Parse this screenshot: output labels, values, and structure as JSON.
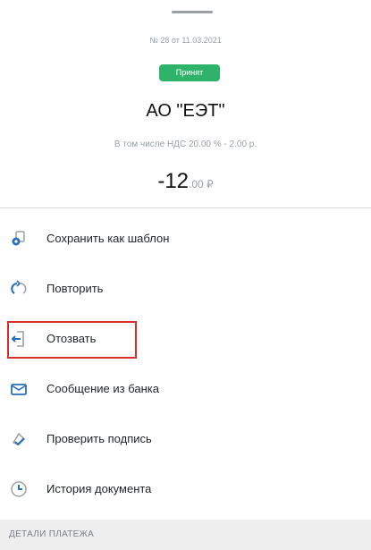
{
  "header": {
    "doc_number": "№ 28   от 11.03.2021",
    "status_badge": "Принят",
    "company": "АО \"ЕЭТ\"",
    "vat_text": "В том числе НДС 20.00 % - 2.00 р.",
    "amount_main": "-12",
    "amount_cents": ".00 ₽"
  },
  "menu": {
    "save_template": "Сохранить как шаблон",
    "repeat": "Повторить",
    "revoke": "Отозвать",
    "bank_message": "Сообщение из банка",
    "verify_signature": "Проверить подпись",
    "document_history": "История документа"
  },
  "section": {
    "details_title": "ДЕТАЛИ ПЛАТЕЖА"
  },
  "colors": {
    "status_green": "#2fb36b",
    "highlight_red": "#d32f2f",
    "icon_blue": "#2b6fb6"
  }
}
